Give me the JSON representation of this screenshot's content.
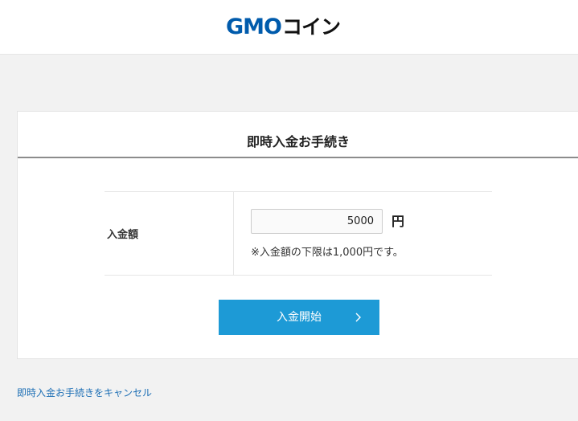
{
  "header": {
    "logo_gmo": "GMO",
    "logo_coin": "コイン"
  },
  "form": {
    "title": "即時入金お手続き",
    "amount_label": "入金額",
    "amount_value": "5000",
    "unit": "円",
    "note": "※入金額の下限は1,000円です。",
    "submit_label": "入金開始"
  },
  "footer": {
    "cancel_label": "即時入金お手続きをキャンセル"
  },
  "colors": {
    "brand_blue": "#005bac",
    "button": "#1d9ad6",
    "link": "#1d6fb5"
  }
}
